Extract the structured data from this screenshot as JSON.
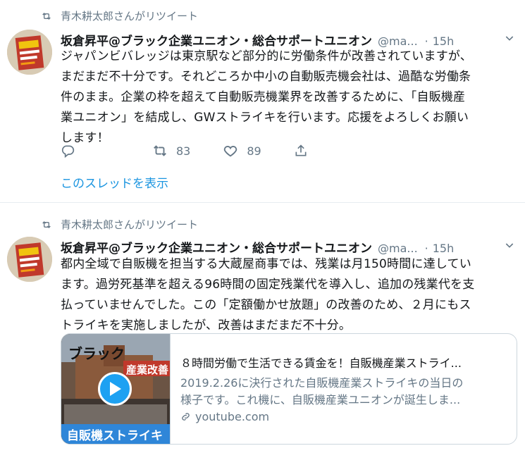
{
  "tweets": [
    {
      "retweeted_by": "青木耕太郎さんがリツイート",
      "name": "坂倉昇平@ブラック企業ユニオン・総合サポートユニオン",
      "handle": "@ma...",
      "dot": "·",
      "time": "15h",
      "text_lines": [
        "ジャパンビバレッジは東京駅など部分的に労働条件が改善されていますが、",
        "まだまだ不十分です。それどころか中小の自動販売機会社は、過酷な労働条",
        "件のまま。企業の枠を超えて自動販売機業界を改善するために、「自販機産",
        "業ユニオン」を結成し、GWストライキを行います。応援をよろしくお願い",
        "します！"
      ],
      "retweets": "83",
      "likes": "89",
      "thread_link": "このスレッドを表示"
    },
    {
      "retweeted_by": "青木耕太郎さんがリツイート",
      "name": "坂倉昇平@ブラック企業ユニオン・総合サポートユニオン",
      "handle": "@ma...",
      "dot": "·",
      "time": "15h",
      "text_lines": [
        "都内全域で自販機を担当する大蔵屋商事では、残業は月150時間に達してい",
        "ます。過労死基準を超える96時間の固定残業代を導入し、追加の残業代を支",
        "払っていませんでした。この「定額働かせ放題」の改善のため、２月にもス",
        "トライキを実施しましたが、改善はまだまだ不十分。"
      ],
      "card": {
        "title": "８時間労働で生活できる賃金を！自販機産業ストライ...",
        "desc_lines": [
          "2019.2.26に決行された自販機産業ストライキの当日の",
          "様子です。これ機に、自販機産業ユニオンが誕生しま..."
        ],
        "domain": "youtube.com",
        "thumb_text_top": "ブラック",
        "thumb_text_red": "産業改善",
        "thumb_text_banner": "自販機ストライキ"
      }
    }
  ],
  "colors": {
    "link": "#1b95e0",
    "secondary": "#657786",
    "border": "#e6ecf0"
  }
}
